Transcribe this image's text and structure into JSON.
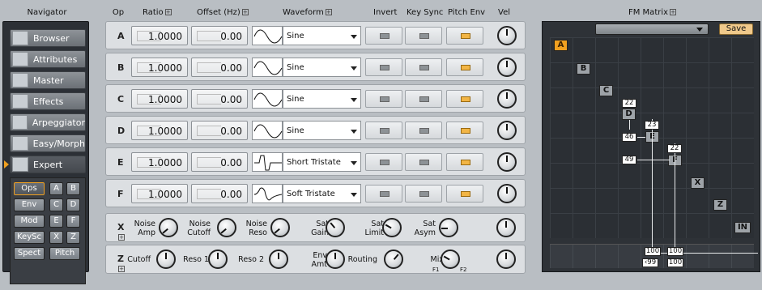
{
  "headers": {
    "navigator": "Navigator",
    "op": "Op",
    "ratio": "Ratio",
    "offset": "Offset (Hz)",
    "waveform": "Waveform",
    "invert": "Invert",
    "key_sync": "Key Sync",
    "pitch_env": "Pitch Env",
    "vel": "Vel",
    "fm_matrix": "FM Matrix"
  },
  "nav": {
    "items": [
      {
        "label": "Browser",
        "icon": "list-icon"
      },
      {
        "label": "Attributes",
        "icon": "attributes-icon"
      },
      {
        "label": "Master",
        "icon": "master-gear-icon"
      },
      {
        "label": "Effects",
        "icon": "effects-spiral-icon"
      },
      {
        "label": "Arpeggiator",
        "icon": "stairs-icon"
      },
      {
        "label": "Easy/Morph",
        "icon": "grid-cross-icon"
      },
      {
        "label": "Expert",
        "icon": "matrix-icon",
        "selected": true
      }
    ]
  },
  "sub_buttons": [
    {
      "label": "Ops",
      "selected": true
    },
    {
      "label": "A"
    },
    {
      "label": "B"
    },
    {
      "label": "Env"
    },
    {
      "label": "C"
    },
    {
      "label": "D"
    },
    {
      "label": "Mod"
    },
    {
      "label": "E"
    },
    {
      "label": "F"
    },
    {
      "label": "KeySc"
    },
    {
      "label": "X"
    },
    {
      "label": "Z"
    },
    {
      "label": "Spect"
    },
    {
      "label": "Pitch"
    }
  ],
  "operators": [
    {
      "name": "A",
      "ratio": "1.0000",
      "offset": "0.00",
      "waveform": "Sine",
      "pitch_env": true
    },
    {
      "name": "B",
      "ratio": "1.0000",
      "offset": "0.00",
      "waveform": "Sine",
      "pitch_env": true
    },
    {
      "name": "C",
      "ratio": "1.0000",
      "offset": "0.00",
      "waveform": "Sine",
      "pitch_env": true
    },
    {
      "name": "D",
      "ratio": "1.0000",
      "offset": "0.00",
      "waveform": "Sine",
      "pitch_env": true
    },
    {
      "name": "E",
      "ratio": "1.0000",
      "offset": "0.00",
      "waveform": "Short Tristate",
      "pitch_env": true
    },
    {
      "name": "F",
      "ratio": "1.0000",
      "offset": "0.00",
      "waveform": "Soft Tristate",
      "pitch_env": true
    }
  ],
  "x_row": {
    "name": "X",
    "knobs": [
      {
        "l1": "Noise",
        "l2": "Amp"
      },
      {
        "l1": "Noise",
        "l2": "Cutoff"
      },
      {
        "l1": "Noise",
        "l2": "Reso"
      },
      {
        "l1": "Sat",
        "l2": "Gain"
      },
      {
        "l1": "Sat",
        "l2": "Limit"
      },
      {
        "l1": "Sat",
        "l2": "Asym"
      }
    ]
  },
  "z_row": {
    "name": "Z",
    "knobs": [
      {
        "l1": "Cutoff",
        "l2": ""
      },
      {
        "l1": "Reso 1",
        "l2": ""
      },
      {
        "l1": "Reso 2",
        "l2": ""
      },
      {
        "l1": "Env",
        "l2": "Amt"
      },
      {
        "l1": "Routing",
        "l2": ""
      },
      {
        "l1": "Mix",
        "l2": ""
      }
    ],
    "mix_f1": "F1",
    "mix_f2": "F2"
  },
  "fm_matrix": {
    "save_label": "Save",
    "ops": [
      "A",
      "B",
      "C",
      "D",
      "E",
      "F",
      "X",
      "Z",
      "IN"
    ],
    "values": {
      "d_self": "22",
      "e_self": "23",
      "e_from_d": "46",
      "f_self": "22",
      "f_from_d": "49",
      "out_e": "100",
      "out_f": "100",
      "out_e2": "‹99",
      "out_f2": "100"
    }
  },
  "colors": {
    "accent": "#f0a020",
    "led_on": "#f2b545",
    "panel": "#dcdfe2"
  }
}
